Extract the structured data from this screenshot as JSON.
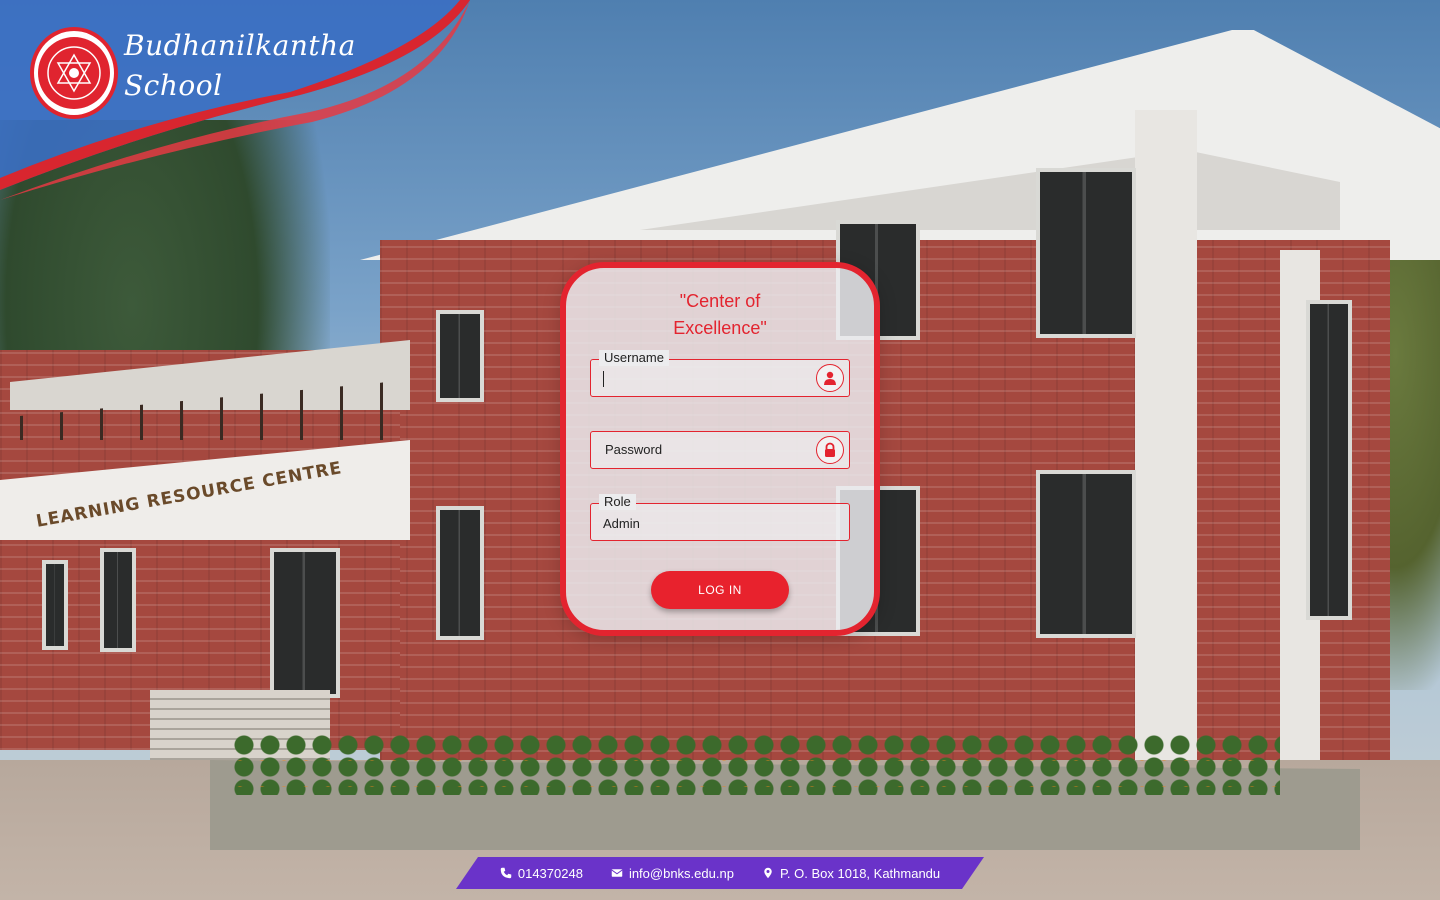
{
  "brand": {
    "line1": "Budhanilkantha",
    "line2": "School",
    "logo_icon": "school-crest-icon",
    "primary_color": "#e3242f"
  },
  "login": {
    "tagline_line1": "\"Center of",
    "tagline_line2": "Excellence\"",
    "username": {
      "label": "Username",
      "value": "",
      "icon": "user-icon"
    },
    "password": {
      "placeholder": "Password",
      "icon": "lock-icon"
    },
    "role": {
      "label": "Role",
      "value": "Admin"
    },
    "login_button": "LOG IN",
    "button_color": "#e8222d"
  },
  "contact": {
    "phone": {
      "icon": "phone-icon",
      "text": "014370248"
    },
    "email": {
      "icon": "envelope-icon",
      "text": "info@bnks.edu.np"
    },
    "address": {
      "icon": "map-marker-icon",
      "text": "P. O. Box 1018, Kathmandu"
    },
    "bar_color": "#6a33c9"
  },
  "background": {
    "building_sign": "LEARNING RESOURCE CENTRE"
  }
}
